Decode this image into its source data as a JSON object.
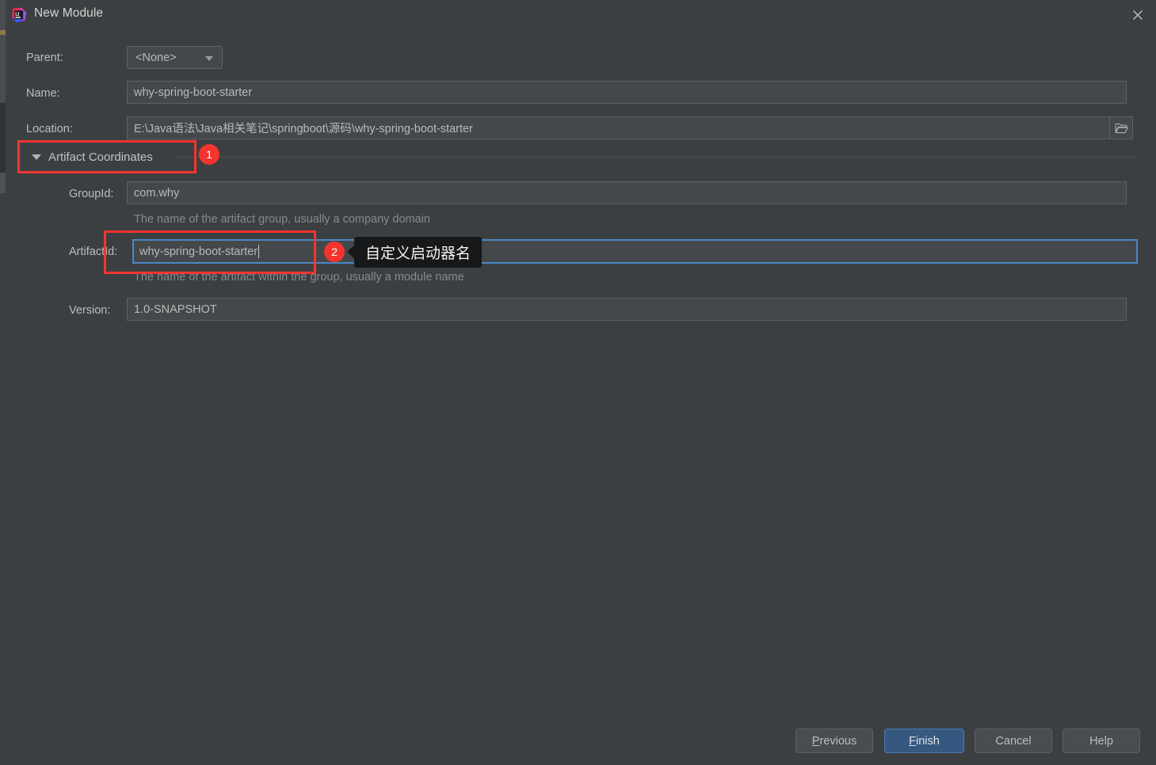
{
  "window": {
    "title": "New Module",
    "app_icon": "intellij-idea-icon",
    "close_icon": "close-icon",
    "background_color": "#3c3f41"
  },
  "form": {
    "parent": {
      "label": "Parent:",
      "value": "<None>",
      "dropdown_icon": "chevron-down-icon"
    },
    "name": {
      "label": "Name:",
      "value": "why-spring-boot-starter"
    },
    "location": {
      "label": "Location:",
      "value": "E:\\Java语法\\Java相关笔记\\springboot\\源码\\why-spring-boot-starter",
      "browse_icon": "folder-icon"
    }
  },
  "section": {
    "title": "Artifact Coordinates",
    "collapse_icon": "triangle-down-icon",
    "group_id": {
      "label": "GroupId:",
      "value": "com.why",
      "hint": "The name of the artifact group, usually a company domain"
    },
    "artifact_id": {
      "label": "ArtifactId:",
      "value": "why-spring-boot-starter",
      "hint": "The name of the artifact within the group, usually a module name"
    },
    "version": {
      "label": "Version:",
      "value": "1.0-SNAPSHOT"
    }
  },
  "annotations": {
    "accent_color": "#f5342e",
    "badge_1": "1",
    "badge_2": "2",
    "tooltip_text": "自定义启动器名"
  },
  "buttons": {
    "previous": "Previous",
    "previous_mnemonic": "P",
    "previous_rest": "revious",
    "finish": "Finish",
    "finish_mnemonic": "F",
    "finish_rest": "inish",
    "cancel": "Cancel",
    "help": "Help",
    "primary_color": "#365880"
  }
}
